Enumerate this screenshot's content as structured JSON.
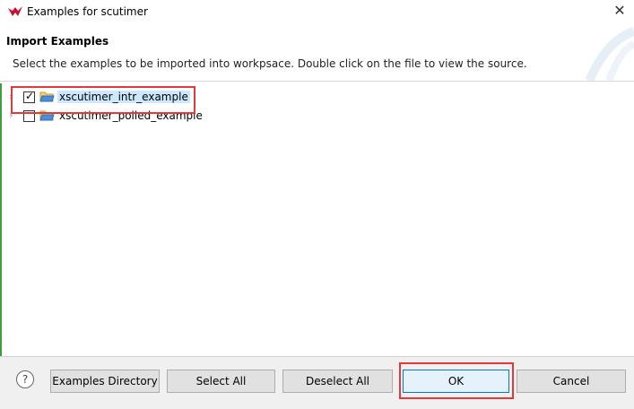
{
  "window": {
    "title": "Examples for scutimer",
    "close_glyph": "✕",
    "icon": "app-logo-icon"
  },
  "header": {
    "title": "Import Examples",
    "description": "Select the examples to be imported into workpsace. Double click on the file to view the source."
  },
  "tree": {
    "items": [
      {
        "label": "xscutimer_intr_example",
        "checked": true,
        "selected": true,
        "icon": "folder-icon"
      },
      {
        "label": "xscutimer_polled_example",
        "checked": false,
        "selected": false,
        "icon": "folder-icon"
      }
    ]
  },
  "buttons": {
    "help_glyph": "?",
    "examples_directory": "Examples Directory",
    "select_all": "Select All",
    "deselect_all": "Deselect All",
    "ok": "OK",
    "cancel": "Cancel"
  },
  "colors": {
    "highlight": "#e23a3a",
    "selection": "#cce8ff",
    "accent": "#0078d7"
  }
}
